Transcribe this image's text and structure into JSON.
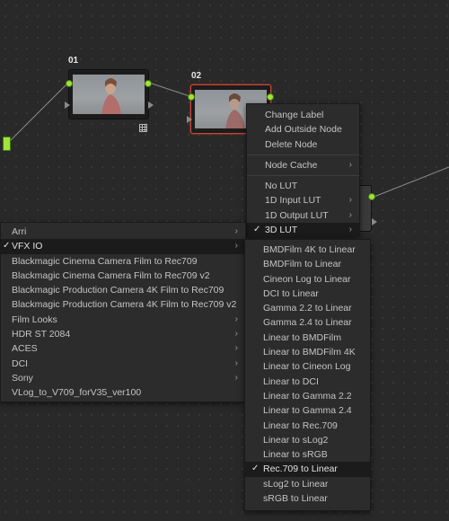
{
  "nodes": {
    "node1_label": "01",
    "node2_label": "02"
  },
  "context_menu": {
    "items": [
      {
        "label": "Change Label"
      },
      {
        "label": "Add Outside Node"
      },
      {
        "label": "Delete Node"
      }
    ],
    "node_cache": "Node Cache",
    "lut_items": [
      {
        "label": "No LUT"
      },
      {
        "label": "1D Input LUT"
      },
      {
        "label": "1D Output LUT"
      },
      {
        "label": "3D LUT"
      }
    ]
  },
  "lut_category_menu": {
    "items": [
      {
        "label": "Arri",
        "submenu": true,
        "checked": false
      },
      {
        "label": "VFX IO",
        "submenu": true,
        "checked": true
      },
      {
        "label": "Blackmagic Cinema Camera Film to Rec709",
        "submenu": false,
        "checked": false
      },
      {
        "label": "Blackmagic Cinema Camera Film to Rec709 v2",
        "submenu": false,
        "checked": false
      },
      {
        "label": "Blackmagic Production Camera 4K Film to Rec709",
        "submenu": false,
        "checked": false
      },
      {
        "label": "Blackmagic Production Camera 4K Film to Rec709 v2",
        "submenu": false,
        "checked": false
      },
      {
        "label": "Film Looks",
        "submenu": true,
        "checked": false
      },
      {
        "label": "HDR ST 2084",
        "submenu": true,
        "checked": false
      },
      {
        "label": "ACES",
        "submenu": true,
        "checked": false
      },
      {
        "label": "DCI",
        "submenu": true,
        "checked": false
      },
      {
        "label": "Sony",
        "submenu": true,
        "checked": false
      },
      {
        "label": "VLog_to_V709_forV35_ver100",
        "submenu": false,
        "checked": false
      }
    ]
  },
  "vfx_io_menu": {
    "items": [
      {
        "label": "BMDFilm 4K to Linear",
        "checked": false
      },
      {
        "label": "BMDFilm to Linear",
        "checked": false
      },
      {
        "label": "Cineon Log to Linear",
        "checked": false
      },
      {
        "label": "DCI to Linear",
        "checked": false
      },
      {
        "label": "Gamma 2.2 to Linear",
        "checked": false
      },
      {
        "label": "Gamma 2.4 to Linear",
        "checked": false
      },
      {
        "label": "Linear to BMDFilm",
        "checked": false
      },
      {
        "label": "Linear to BMDFilm 4K",
        "checked": false
      },
      {
        "label": "Linear to Cineon Log",
        "checked": false
      },
      {
        "label": "Linear to DCI",
        "checked": false
      },
      {
        "label": "Linear to Gamma 2.2",
        "checked": false
      },
      {
        "label": "Linear to Gamma 2.4",
        "checked": false
      },
      {
        "label": "Linear to Rec.709",
        "checked": false
      },
      {
        "label": "Linear to sLog2",
        "checked": false
      },
      {
        "label": "Linear to sRGB",
        "checked": false
      },
      {
        "label": "Rec.709 to Linear",
        "checked": true
      },
      {
        "label": "sLog2 to Linear",
        "checked": false
      },
      {
        "label": "sRGB to Linear",
        "checked": false
      }
    ]
  },
  "glyphs": {
    "arrow": "›",
    "check": "✓"
  },
  "colors": {
    "link": "#9ee43a",
    "selected_border": "#c0493e",
    "menu_bg": "#2c2c2c",
    "highlight": "#1b1b1b"
  }
}
